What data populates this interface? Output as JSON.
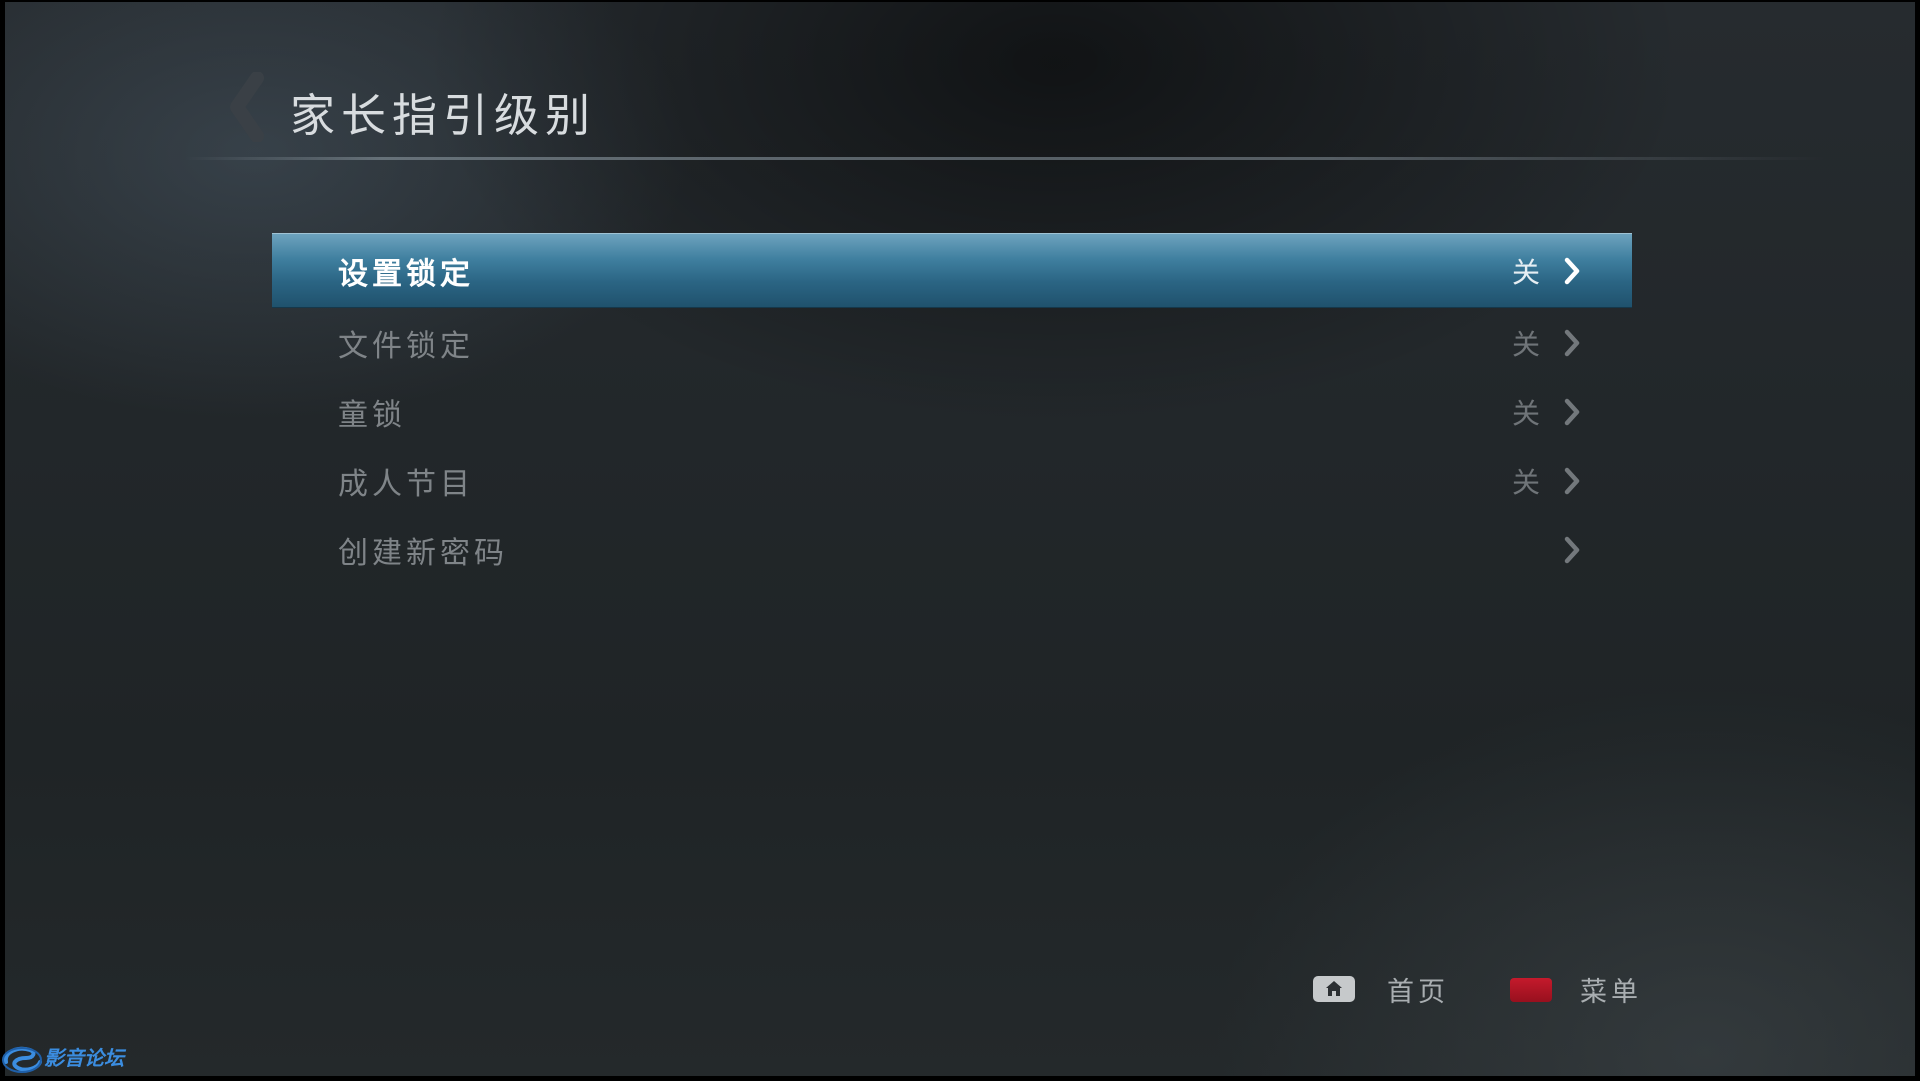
{
  "header": {
    "title": "家长指引级别",
    "back_icon": "chevron-left-icon"
  },
  "menu": {
    "items": [
      {
        "label": "设置锁定",
        "value": "关",
        "icon": "chevron-right-icon",
        "selected": true
      },
      {
        "label": "文件锁定",
        "value": "关",
        "icon": "chevron-right-icon",
        "selected": false
      },
      {
        "label": "童锁",
        "value": "关",
        "icon": "chevron-right-icon",
        "selected": false
      },
      {
        "label": "成人节目",
        "value": "关",
        "icon": "chevron-right-icon",
        "selected": false
      },
      {
        "label": "创建新密码",
        "value": "",
        "icon": "chevron-right-icon",
        "selected": false
      }
    ]
  },
  "footer": {
    "home": {
      "label": "首页",
      "icon": "home-key-icon"
    },
    "menu": {
      "label": "菜单",
      "icon": "red-key-icon"
    }
  },
  "watermark": {
    "text": "影音论坛"
  },
  "colors": {
    "selected_bar": "#2b6584",
    "red_key": "#c51a2c",
    "background": "#22272a"
  }
}
